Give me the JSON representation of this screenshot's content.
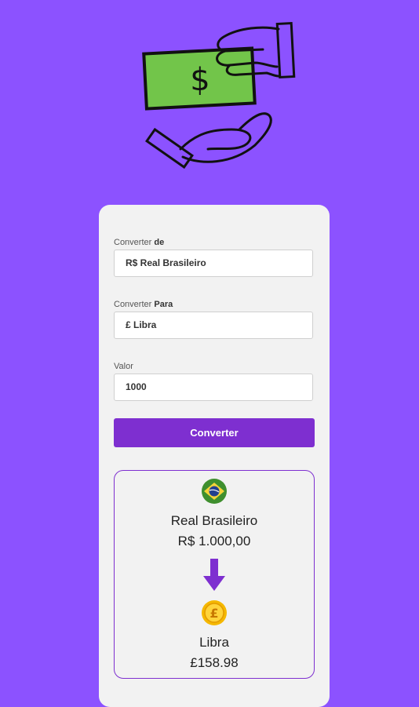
{
  "form": {
    "from_label_prefix": "Converter ",
    "from_label_bold": "de",
    "from_value": "R$ Real Brasileiro",
    "to_label_prefix": "Converter ",
    "to_label_bold": "Para",
    "to_value": "£ Libra",
    "amount_label": "Valor",
    "amount_value": "1000",
    "convert_button": "Converter"
  },
  "result": {
    "from_currency_name": "Real Brasileiro",
    "from_amount": "R$ 1.000,00",
    "to_currency_name": "Libra",
    "to_amount": "£158.98"
  },
  "colors": {
    "background": "#8c52ff",
    "accent": "#7e2fd0",
    "card": "#f2f2f2"
  },
  "icons": {
    "hero": "money-exchange-hands-icon",
    "from": "brazil-flag-icon",
    "arrow": "arrow-down-icon",
    "to": "pound-coin-icon"
  }
}
